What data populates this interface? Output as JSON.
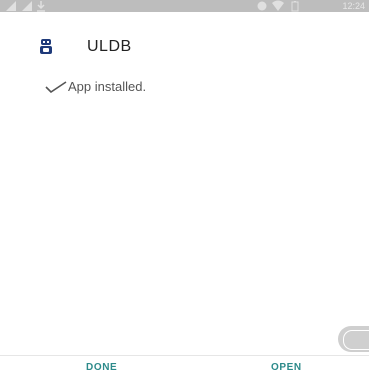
{
  "status_bar": {
    "time": "12:24",
    "icons": [
      "signal-icon",
      "signal-icon",
      "download-icon",
      "alarm-icon",
      "wifi-icon",
      "battery-icon"
    ]
  },
  "header": {
    "app_name": "ULDB",
    "icon": "uldb-app-icon"
  },
  "install_status": {
    "text": "App installed.",
    "icon": "check-icon"
  },
  "footer": {
    "done_label": "DONE",
    "open_label": "OPEN"
  },
  "colors": {
    "accent": "#2c8a8a",
    "status_bar": "#bdbdbd",
    "text_primary": "#222222",
    "text_secondary": "#555555"
  }
}
